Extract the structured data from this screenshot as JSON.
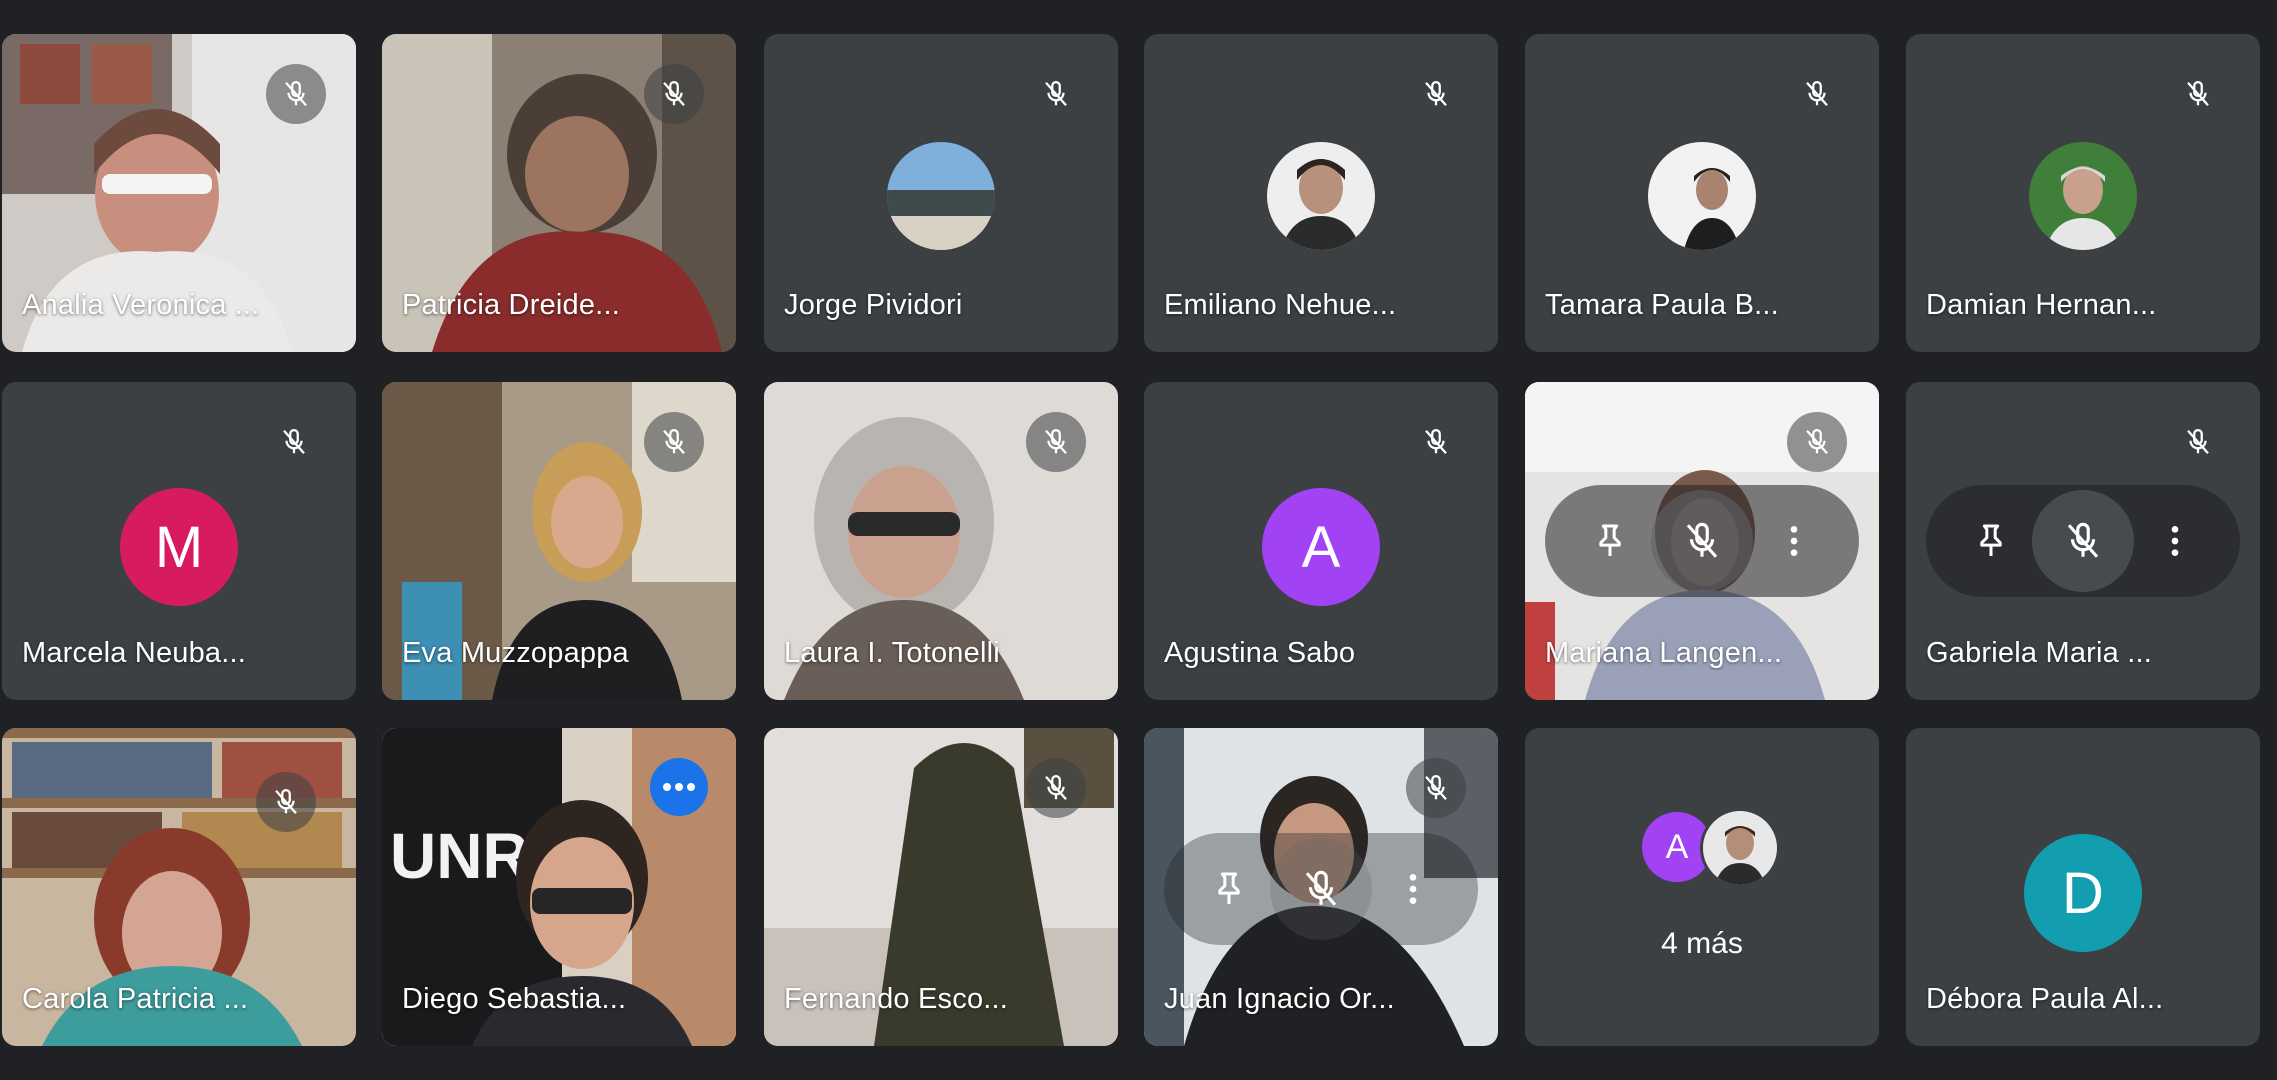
{
  "meeting": {
    "participants": [
      {
        "name": "Analia Veronica ...",
        "muted": true
      },
      {
        "name": "Patricia Dreide...",
        "muted": true
      },
      {
        "name": "Jorge Pividori",
        "muted": true
      },
      {
        "name": "Emiliano Nehue...",
        "muted": true
      },
      {
        "name": "Tamara Paula B...",
        "muted": true
      },
      {
        "name": "Damian Hernan...",
        "muted": true
      },
      {
        "name": "Marcela Neuba...",
        "initial": "M",
        "avatar_color": "#d81b60",
        "muted": true
      },
      {
        "name": "Eva Muzzopappa",
        "muted": true
      },
      {
        "name": "Laura I. Totonelli",
        "muted": true
      },
      {
        "name": "Agustina Sabo",
        "initial": "A",
        "avatar_color": "#a142f4",
        "muted": true
      },
      {
        "name": "Mariana Langen...",
        "muted": true
      },
      {
        "name": "Gabriela Maria ...",
        "muted": true
      },
      {
        "name": "Carola Patricia ...",
        "muted": true
      },
      {
        "name": "Diego Sebastia...",
        "speaking": true
      },
      {
        "name": "Fernando Esco...",
        "muted": true
      },
      {
        "name": "Juan Ignacio Or...",
        "muted": true
      },
      {
        "name": "Débora Paula Al...",
        "initial": "D",
        "avatar_color": "#129eaf",
        "muted": false
      }
    ],
    "more_tile": {
      "label": "4 más",
      "first_initial": "A",
      "first_color": "#a142f4"
    }
  },
  "icons": [
    "mic-off-icon",
    "pin-icon",
    "more-vert-icon",
    "more-horiz-icon"
  ],
  "colors": {
    "background": "#202124",
    "tile": "#3c4043",
    "speaking_outline": "#8ab4f8",
    "more_button": "#1a73e8"
  }
}
